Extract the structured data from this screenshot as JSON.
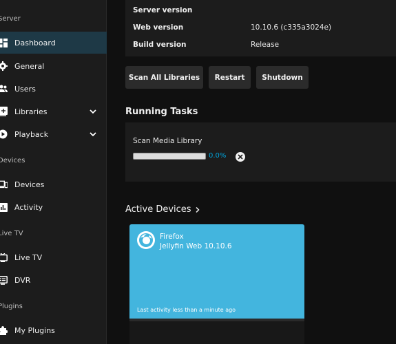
{
  "sidebar": {
    "sections": {
      "server": "Server",
      "devices": "Devices",
      "livetv": "Live TV",
      "plugins": "Plugins"
    },
    "items": [
      {
        "label": "Dashboard",
        "icon": "dashboard-icon",
        "active": true
      },
      {
        "label": "General",
        "icon": "gear-icon"
      },
      {
        "label": "Users",
        "icon": "users-icon"
      },
      {
        "label": "Libraries",
        "icon": "library-add-icon",
        "expandable": true
      },
      {
        "label": "Playback",
        "icon": "play-circle-icon",
        "expandable": true
      },
      {
        "label": "Devices",
        "icon": "devices-icon"
      },
      {
        "label": "Activity",
        "icon": "activity-icon"
      },
      {
        "label": "Live TV",
        "icon": "tv-icon"
      },
      {
        "label": "DVR",
        "icon": "dvr-icon"
      },
      {
        "label": "My Plugins",
        "icon": "puzzle-icon"
      }
    ]
  },
  "server_info": {
    "rows": [
      {
        "label": "Server version",
        "value": ""
      },
      {
        "label": "Web version",
        "value": "10.10.6 (c335a3024e)"
      },
      {
        "label": "Build version",
        "value": "Release"
      }
    ]
  },
  "actions": {
    "scan_all": "Scan All Libraries",
    "restart": "Restart",
    "shutdown": "Shutdown"
  },
  "running_tasks": {
    "title": "Running Tasks",
    "task_name": "Scan Media Library",
    "progress": 0.0,
    "progress_text": "0.0%"
  },
  "active_devices": {
    "title": "Active Devices",
    "title_icon": "chevron-right-icon",
    "devices": [
      {
        "name": "Firefox",
        "client": "Jellyfin Web 10.10.6",
        "last_activity": "Last activity less than a minute ago",
        "icon": "firefox-icon"
      }
    ]
  },
  "colors": {
    "accent": "#00a4dc",
    "card": "#43b5de",
    "sidebar_active": "#1e3946",
    "panel": "#1c1c1c",
    "background": "#101010"
  }
}
